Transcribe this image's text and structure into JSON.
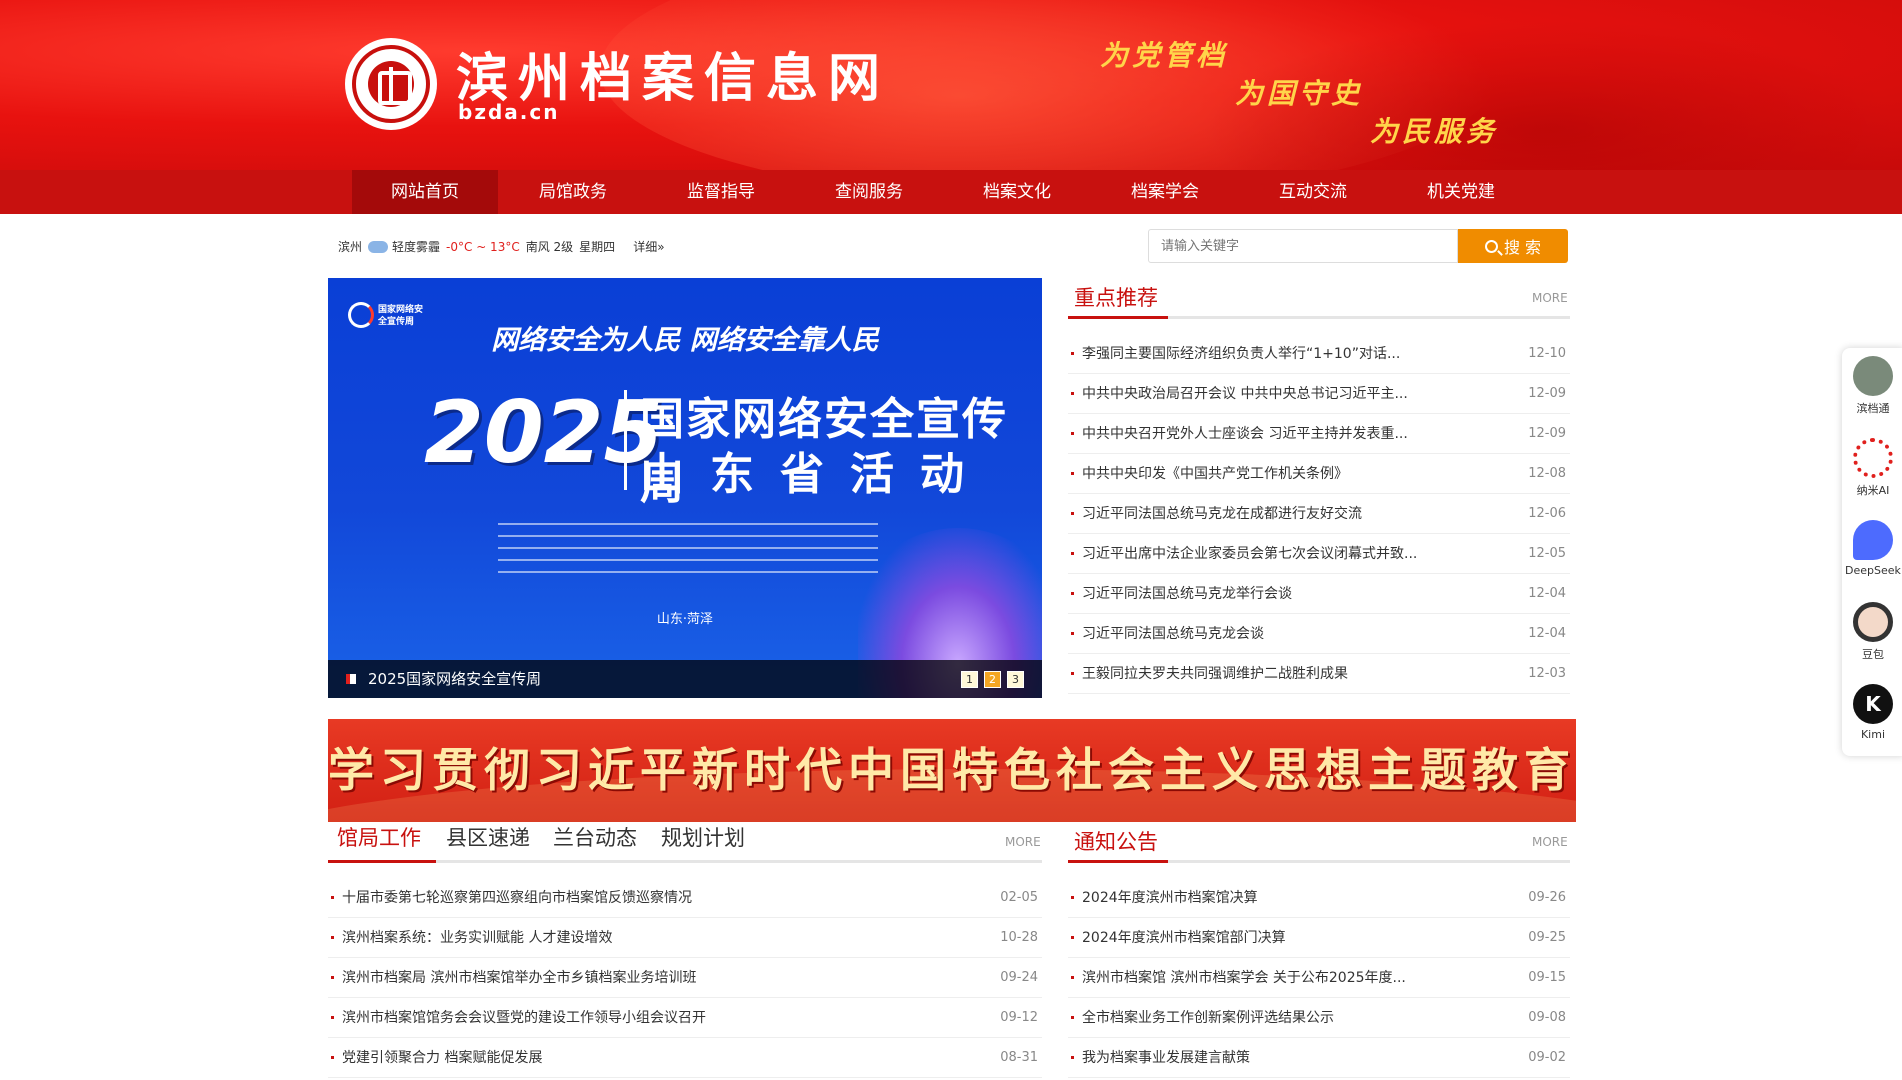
{
  "header": {
    "site_title": "滨州档案信息网",
    "site_domain": "bzda.cn",
    "logo_text": "中国档案 CHINA ARCHIVES",
    "slogans": [
      "为党管档",
      "为国守史",
      "为民服务"
    ]
  },
  "nav": {
    "items": [
      "网站首页",
      "局馆政务",
      "监督指导",
      "查阅服务",
      "档案文化",
      "档案学会",
      "互动交流",
      "机关党建"
    ],
    "active_index": 0
  },
  "weather": {
    "city": "滨州",
    "condition": "轻度雾霾",
    "temp": "-0°C ~ 13°C",
    "wind": "南风 2级",
    "weekday": "星期四",
    "detail_link": "详细»"
  },
  "search": {
    "placeholder": "请输入关键字",
    "button_label": "搜 索"
  },
  "slider": {
    "logo_text": "国家网络安全宣传周",
    "slogan": "网络安全为人民  网络安全靠人民",
    "year": "2025",
    "title_line1": "国家网络安全宣传周",
    "title_line2": "山东省活动",
    "place": "山东·菏泽",
    "caption": "2025国家网络安全宣传周",
    "pages": [
      "1",
      "2",
      "3"
    ],
    "active_page": 2
  },
  "featured": {
    "title": "重点推荐",
    "more": "MORE",
    "items": [
      {
        "title": "李强同主要国际经济组织负责人举行“1+10”对话...",
        "date": "12-10"
      },
      {
        "title": "中共中央政治局召开会议 中共中央总书记习近平主...",
        "date": "12-09"
      },
      {
        "title": "中共中央召开党外人士座谈会 习近平主持并发表重...",
        "date": "12-09"
      },
      {
        "title": "中共中央印发《中国共产党工作机关条例》",
        "date": "12-08"
      },
      {
        "title": "习近平同法国总统马克龙在成都进行友好交流",
        "date": "12-06"
      },
      {
        "title": "习近平出席中法企业家委员会第七次会议闭幕式并致...",
        "date": "12-05"
      },
      {
        "title": "习近平同法国总统马克龙举行会谈",
        "date": "12-04"
      },
      {
        "title": "习近平同法国总统马克龙会谈",
        "date": "12-04"
      },
      {
        "title": "王毅同拉夫罗夫共同强调维护二战胜利成果",
        "date": "12-03"
      }
    ]
  },
  "study_banner": {
    "text": "学习贯彻习近平新时代中国特色社会主义思想主题教育"
  },
  "work": {
    "tabs": [
      "馆局工作",
      "县区速递",
      "兰台动态",
      "规划计划"
    ],
    "active_tab": 0,
    "more": "MORE",
    "items": [
      {
        "title": "十届市委第七轮巡察第四巡察组向市档案馆反馈巡察情况",
        "date": "02-05"
      },
      {
        "title": "滨州档案系统：业务实训赋能 人才建设增效",
        "date": "10-28"
      },
      {
        "title": "滨州市档案局 滨州市档案馆举办全市乡镇档案业务培训班",
        "date": "09-24"
      },
      {
        "title": "滨州市档案馆馆务会会议暨党的建设工作领导小组会议召开",
        "date": "09-12"
      },
      {
        "title": "党建引领聚合力 档案赋能促发展",
        "date": "08-31"
      }
    ]
  },
  "notice": {
    "title": "通知公告",
    "more": "MORE",
    "items": [
      {
        "title": "2024年度滨州市档案馆决算",
        "date": "09-26"
      },
      {
        "title": "2024年度滨州市档案馆部门决算",
        "date": "09-25"
      },
      {
        "title": "滨州市档案馆 滨州市档案学会 关于公布2025年度...",
        "date": "09-15"
      },
      {
        "title": "全市档案业务工作创新案例评选结果公示",
        "date": "09-08"
      },
      {
        "title": "我为档案事业发展建言献策",
        "date": "09-02"
      }
    ]
  },
  "ai_sidebar": {
    "items": [
      {
        "label": "滨档通",
        "icon": "avatar-icon",
        "color": "#7a8a7a"
      },
      {
        "label": "纳米AI",
        "icon": "nano-ai-icon",
        "color": "#e0201d"
      },
      {
        "label": "DeepSeek",
        "icon": "deepseek-icon",
        "color": "#4d6bfe"
      },
      {
        "label": "豆包",
        "icon": "doubao-icon",
        "color": "#f3d9c9"
      },
      {
        "label": "Kimi",
        "icon": "kimi-icon",
        "color": "#111111"
      }
    ]
  },
  "colors": {
    "brand_red": "#c8110f",
    "search_orange": "#f08c00",
    "slogan_gold": "#ffd54a"
  }
}
